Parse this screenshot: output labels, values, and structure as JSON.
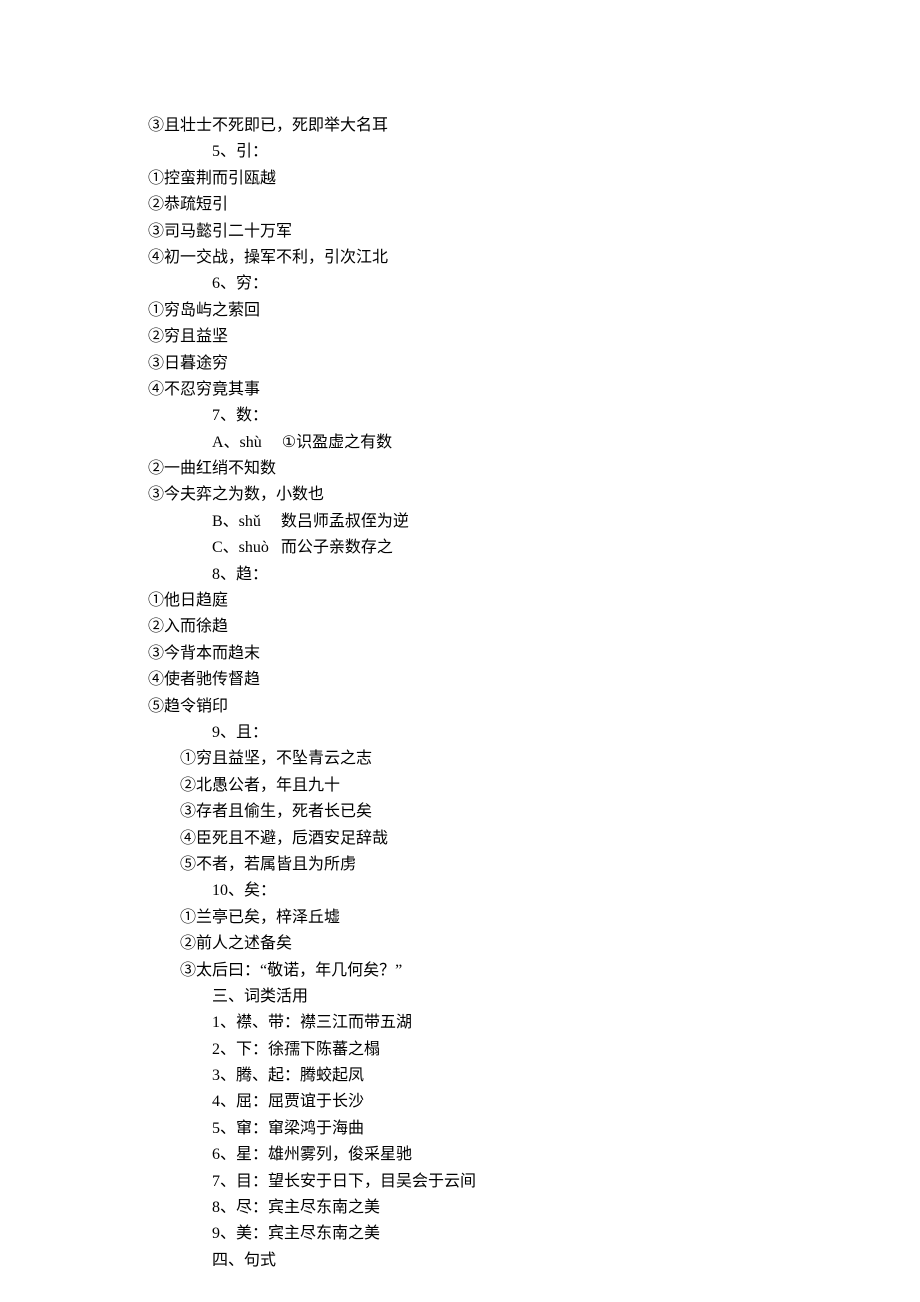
{
  "lines": [
    {
      "cls": "line",
      "text": "③且壮士不死即已，死即举大名耳"
    },
    {
      "cls": "line indent1",
      "text": "5、引："
    },
    {
      "cls": "line",
      "text": "①控蛮荆而引瓯越"
    },
    {
      "cls": "line",
      "text": "②恭疏短引"
    },
    {
      "cls": "line",
      "text": "③司马懿引二十万军"
    },
    {
      "cls": "line",
      "text": "④初一交战，操军不利，引次江北"
    },
    {
      "cls": "line indent1",
      "text": "6、穷："
    },
    {
      "cls": "line",
      "text": "①穷岛屿之萦回"
    },
    {
      "cls": "line",
      "text": "②穷且益坚"
    },
    {
      "cls": "line",
      "text": "③日暮途穷"
    },
    {
      "cls": "line",
      "text": "④不忍穷竟其事"
    },
    {
      "cls": "line indent1",
      "text": "7、数："
    },
    {
      "cls": "line indent1",
      "text": "A、shù     ①识盈虚之有数"
    },
    {
      "cls": "line",
      "text": "②一曲红绡不知数"
    },
    {
      "cls": "line",
      "text": "③今夫弈之为数，小数也"
    },
    {
      "cls": "line indent1",
      "text": "B、shǔ     数吕师孟叔侄为逆"
    },
    {
      "cls": "line indent1",
      "text": "C、shuò   而公子亲数存之"
    },
    {
      "cls": "line indent1",
      "text": "8、趋："
    },
    {
      "cls": "line",
      "text": "①他日趋庭"
    },
    {
      "cls": "line",
      "text": "②入而徐趋"
    },
    {
      "cls": "line",
      "text": "③今背本而趋末"
    },
    {
      "cls": "line",
      "text": "④使者驰传督趋"
    },
    {
      "cls": "line",
      "text": "⑤趋令销印"
    },
    {
      "cls": "line indent1",
      "text": "9、且："
    },
    {
      "cls": "line indent2",
      "text": "①穷且益坚，不坠青云之志"
    },
    {
      "cls": "line indent2",
      "text": "②北愚公者，年且九十"
    },
    {
      "cls": "line indent2",
      "text": "③存者且偷生，死者长已矣"
    },
    {
      "cls": "line indent2",
      "text": "④臣死且不避，卮酒安足辞哉"
    },
    {
      "cls": "line indent2",
      "text": "⑤不者，若属皆且为所虏"
    },
    {
      "cls": "line indent1",
      "text": "10、矣："
    },
    {
      "cls": "line indent2",
      "text": "①兰亭已矣，梓泽丘墟"
    },
    {
      "cls": "line indent2",
      "text": "②前人之述备矣"
    },
    {
      "cls": "line indent2",
      "text": "③太后曰：“敬诺，年几何矣？”"
    },
    {
      "cls": "line indent1",
      "text": "三、词类活用"
    },
    {
      "cls": "line indent1",
      "text": "1、襟、带：襟三江而带五湖"
    },
    {
      "cls": "line indent1",
      "text": "2、下：徐孺下陈蕃之榻"
    },
    {
      "cls": "line indent1",
      "text": "3、腾、起：腾蛟起凤"
    },
    {
      "cls": "line indent1",
      "text": "4、屈：屈贾谊于长沙"
    },
    {
      "cls": "line indent1",
      "text": "5、窜：窜梁鸿于海曲"
    },
    {
      "cls": "line indent1",
      "text": "6、星：雄州雾列，俊采星驰"
    },
    {
      "cls": "line indent1",
      "text": "7、目：望长安于日下，目吴会于云间"
    },
    {
      "cls": "line indent1",
      "text": "8、尽：宾主尽东南之美"
    },
    {
      "cls": "line indent1",
      "text": "9、美：宾主尽东南之美"
    },
    {
      "cls": "line indent1",
      "text": "四、句式"
    }
  ]
}
